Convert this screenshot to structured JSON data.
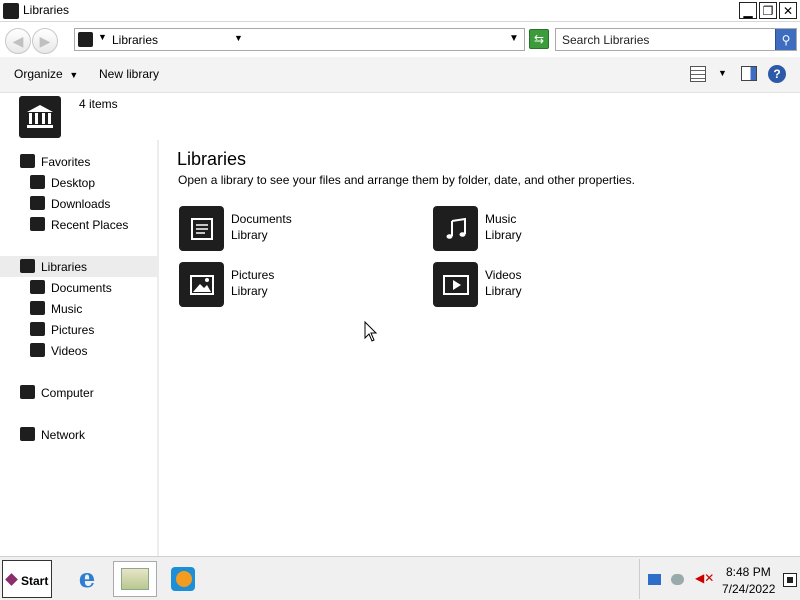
{
  "window": {
    "title": "Libraries",
    "minimize_icon": "minimize-icon",
    "maximize_icon": "restore-icon",
    "close_icon": "close-icon"
  },
  "address_bar": {
    "breadcrumb": "Libraries",
    "search_placeholder": "Search Libraries"
  },
  "toolbar": {
    "organize_label": "Organize",
    "new_library_label": "New library"
  },
  "details": {
    "item_count": "4 items"
  },
  "nav": {
    "favorites": "Favorites",
    "desktop": "Desktop",
    "downloads": "Downloads",
    "recent_places": "Recent Places",
    "libraries": "Libraries",
    "documents": "Documents",
    "music": "Music",
    "pictures": "Pictures",
    "videos": "Videos",
    "computer": "Computer",
    "network": "Network"
  },
  "main": {
    "heading": "Libraries",
    "subtitle": "Open a library to see your files and arrange them by folder, date, and other properties.",
    "libraries": [
      {
        "name": "Documents",
        "type": "Library",
        "icon": "documents-icon"
      },
      {
        "name": "Music",
        "type": "Library",
        "icon": "music-icon"
      },
      {
        "name": "Pictures",
        "type": "Library",
        "icon": "pictures-icon"
      },
      {
        "name": "Videos",
        "type": "Library",
        "icon": "videos-icon"
      }
    ]
  },
  "taskbar": {
    "start_label": "Start",
    "apps": [
      "internet-explorer-icon",
      "windows-explorer-icon",
      "media-player-icon"
    ],
    "clock_time": "8:48 PM",
    "clock_date": "7/24/2022"
  },
  "colors": {
    "icon_dark": "#1e1e1e",
    "accent_blue": "#3d6cc0",
    "nav_selected": "#ececec"
  }
}
